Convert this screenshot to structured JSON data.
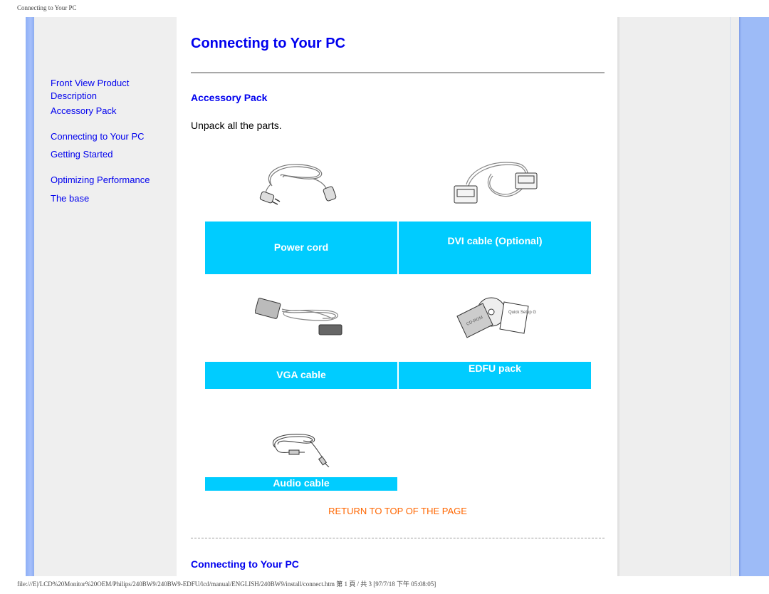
{
  "print_header": "Connecting to Your PC",
  "print_footer": "file:///E|/LCD%20Monitor%20OEM/Philips/240BW9/240BW9-EDFU/lcd/manual/ENGLISH/240BW9/install/connect.htm 第 1 頁 / 共 3 [97/7/18 下午 05:08:05]",
  "sidebar": {
    "items": [
      {
        "label": "Front View Product Description"
      },
      {
        "label": "Accessory Pack"
      },
      {
        "label": "Connecting to Your PC"
      },
      {
        "label": "Getting Started"
      },
      {
        "label": "Optimizing Performance"
      },
      {
        "label": "The base"
      }
    ]
  },
  "main": {
    "title": "Connecting to Your PC",
    "section1_title": "Accessory Pack",
    "intro": "Unpack all the parts.",
    "accessories": [
      {
        "label": "Power cord",
        "icon": "power-cord-image"
      },
      {
        "label": "DVI cable (Optional)",
        "icon": "dvi-cable-image"
      },
      {
        "label": "VGA cable",
        "icon": "vga-cable-image"
      },
      {
        "label": "EDFU pack",
        "icon": "edfu-pack-image",
        "cd_text": "CD-ROM",
        "guide_text": "Quick Setup Guide"
      },
      {
        "label": "Audio cable",
        "icon": "audio-cable-image"
      }
    ],
    "return_link": "RETURN TO TOP OF THE PAGE",
    "section2_title": "Connecting to Your PC"
  },
  "colors": {
    "link": "#0000ee",
    "label_bg": "#00ccff",
    "return_link": "#ff6600",
    "side_strip": "#9dbbf7",
    "panel_bg": "#efefef"
  }
}
